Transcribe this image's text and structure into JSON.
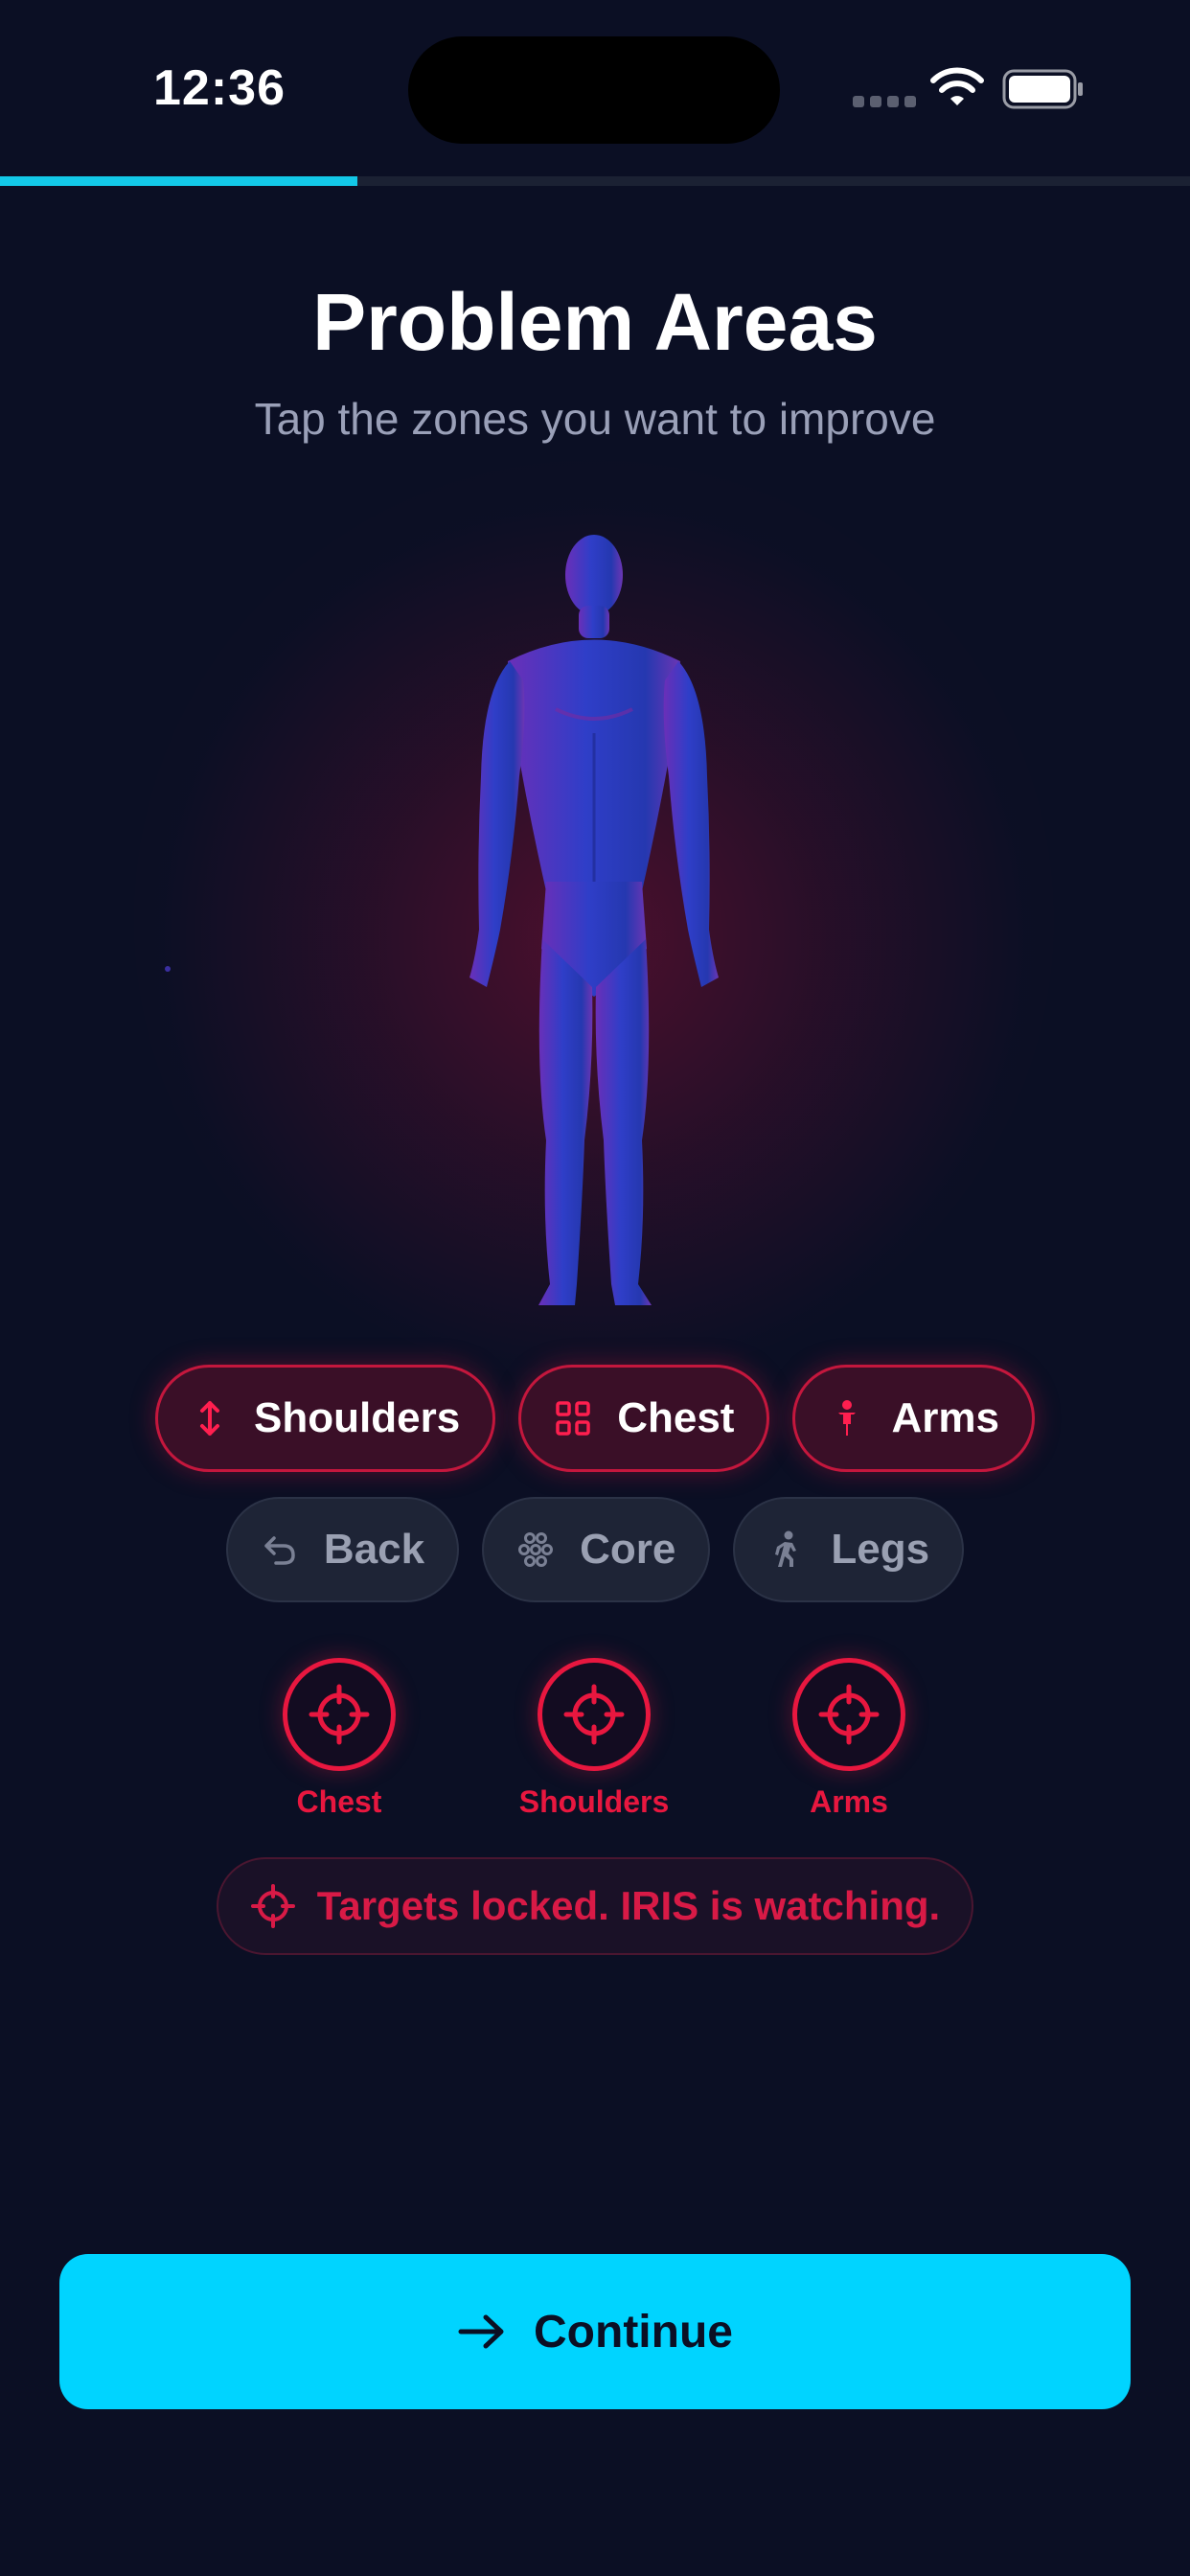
{
  "status_bar": {
    "time": "12:36"
  },
  "progress": {
    "value": 0.3
  },
  "header": {
    "title": "Problem Areas",
    "subtitle": "Tap the zones you want to improve"
  },
  "zones": {
    "selected": [
      {
        "label": "Shoulders",
        "icon": "up-down-arrow-icon"
      },
      {
        "label": "Chest",
        "icon": "grid-icon"
      },
      {
        "label": "Arms",
        "icon": "person-icon"
      }
    ],
    "unselected": [
      {
        "label": "Back",
        "icon": "undo-arrow-icon"
      },
      {
        "label": "Core",
        "icon": "core-dots-icon"
      },
      {
        "label": "Legs",
        "icon": "walking-icon"
      }
    ]
  },
  "targets": [
    {
      "label": "Chest"
    },
    {
      "label": "Shoulders"
    },
    {
      "label": "Arms"
    }
  ],
  "status_message": "Targets locked. IRIS is watching.",
  "continue_button": {
    "label": "Continue",
    "icon": "arrow-right-icon"
  },
  "colors": {
    "background": "#0b0f24",
    "accent": "#00d4ff",
    "danger": "#e8173f",
    "chip_active_bg": "#3a0f27",
    "chip_inactive_bg": "#1e2436"
  }
}
